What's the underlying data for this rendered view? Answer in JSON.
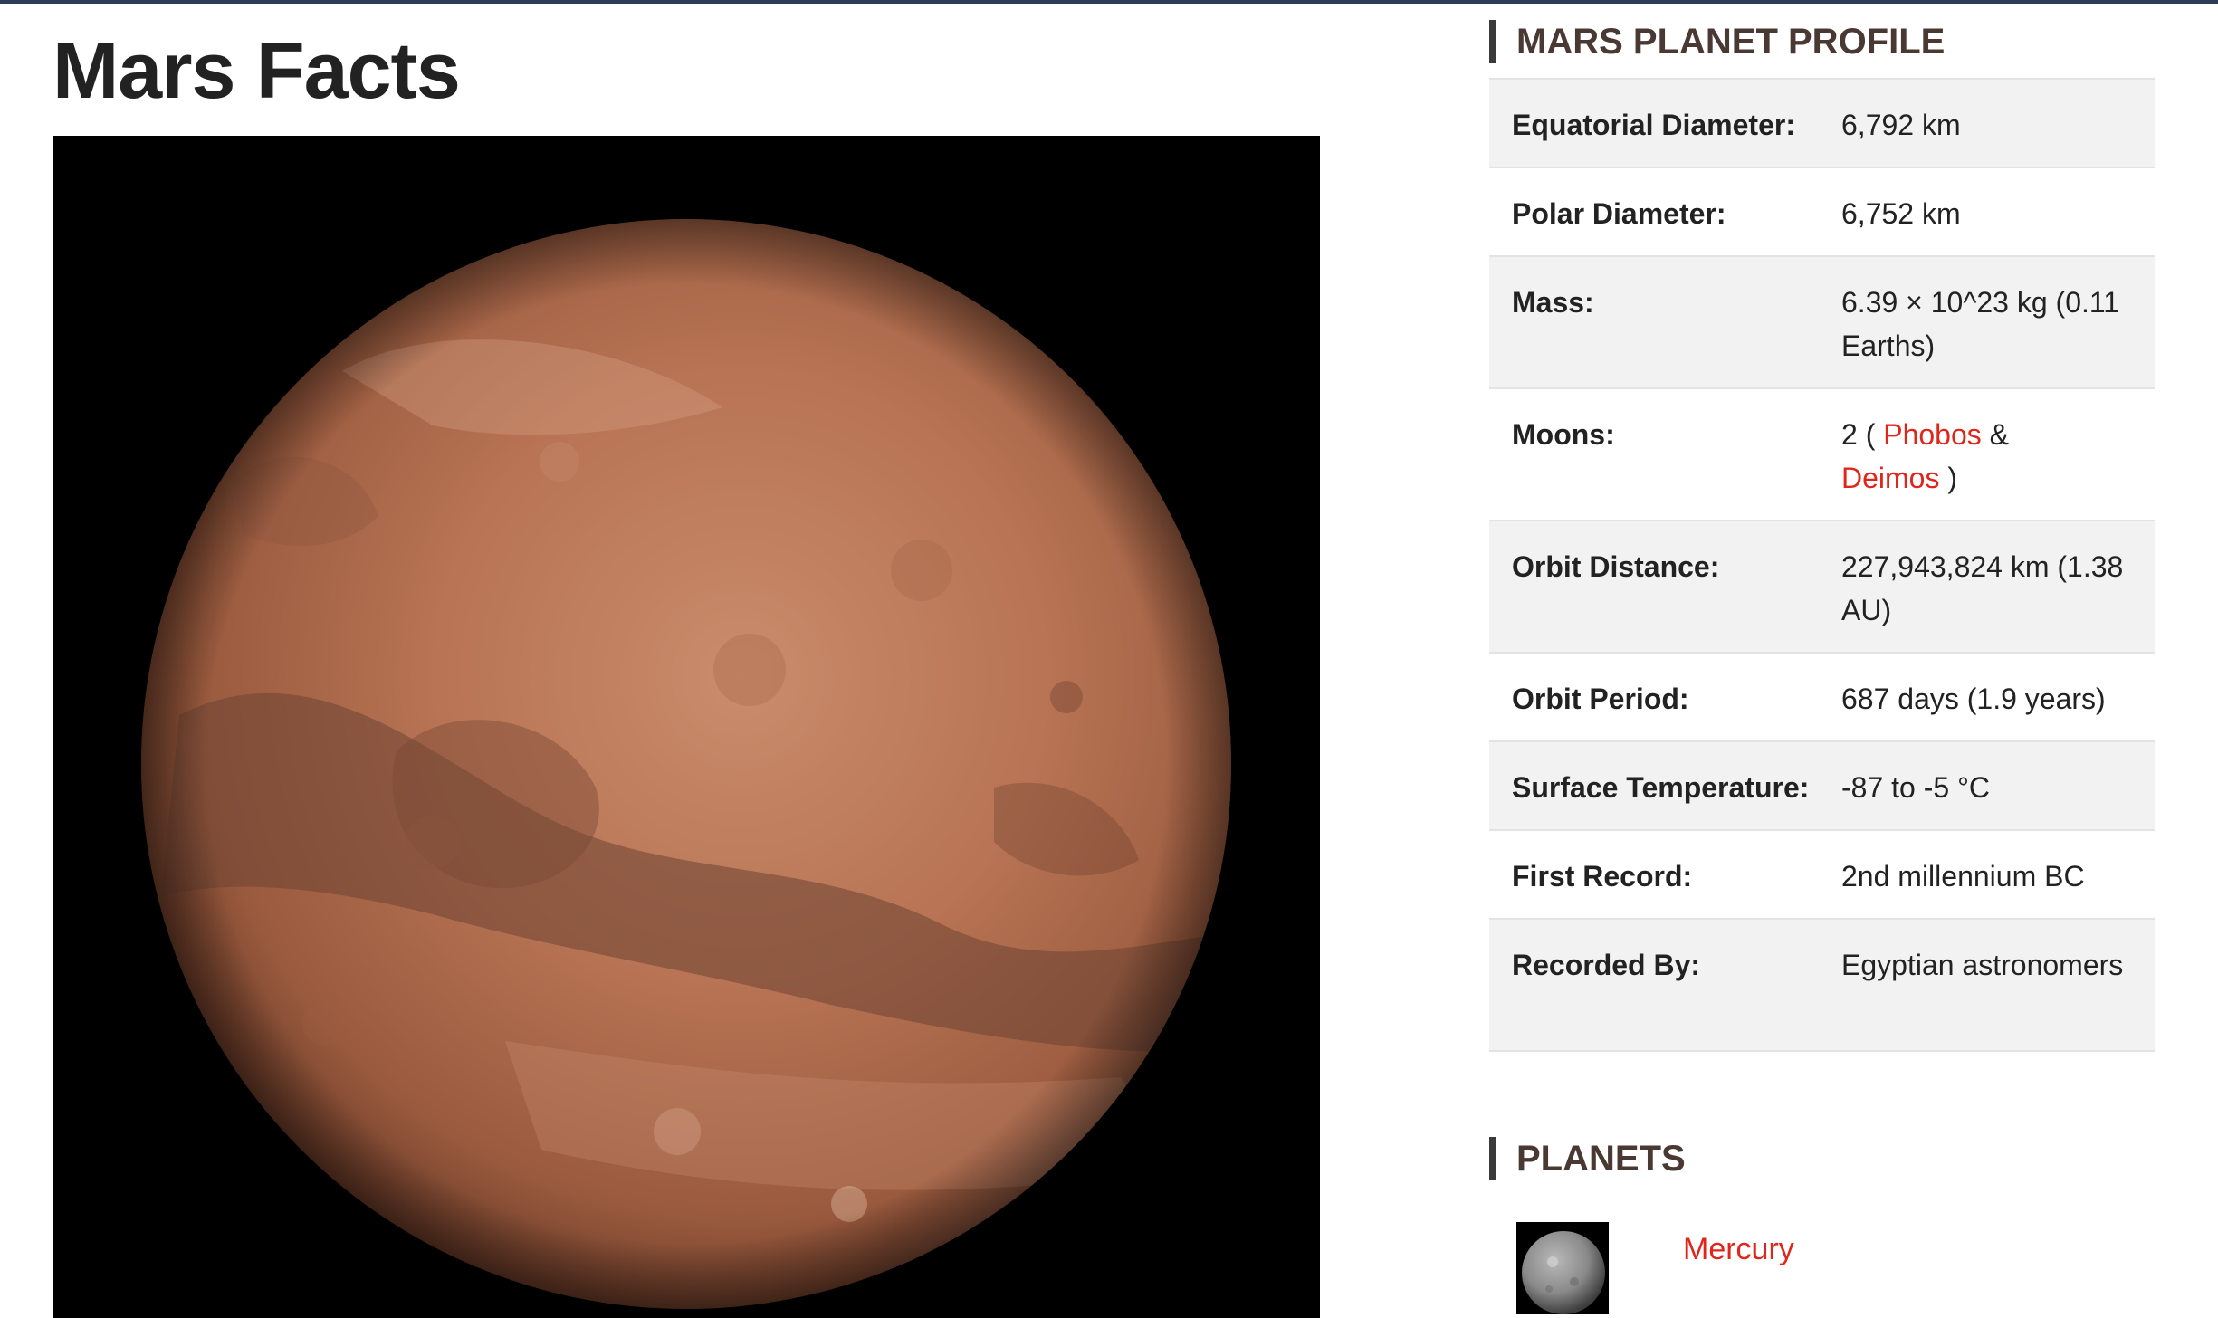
{
  "page": {
    "title": "Mars Facts"
  },
  "hero_image": {
    "alt": "Mars"
  },
  "profile": {
    "heading": "MARS PLANET PROFILE",
    "rows": [
      {
        "label": "Equatorial Diameter:",
        "value": "6,792 km"
      },
      {
        "label": "Polar Diameter:",
        "value": "6,752 km"
      },
      {
        "label": "Mass:",
        "value": "6.39 × 10^23 kg (0.11 Earths)"
      },
      {
        "label": "Moons:",
        "value_prefix": "2 (",
        "moon1": "Phobos",
        "value_sep": "&",
        "moon2": "Deimos",
        "value_suffix": ")"
      },
      {
        "label": "Orbit Distance:",
        "value": "227,943,824 km (1.38 AU)"
      },
      {
        "label": "Orbit Period:",
        "value": "687 days (1.9 years)"
      },
      {
        "label": "Surface Temperature:",
        "value": "-87 to -5 °C"
      },
      {
        "label": "First Record:",
        "value": "2nd millennium BC"
      },
      {
        "label": "Recorded By:",
        "value": "Egyptian astronomers"
      }
    ]
  },
  "planets": {
    "heading": "PLANETS",
    "items": [
      {
        "name": "Mercury"
      }
    ]
  },
  "colors": {
    "accent_link": "#e0261b",
    "heading": "#4a3833",
    "row_shade": "#f2f2f2",
    "top_rule": "#2c3e57"
  }
}
